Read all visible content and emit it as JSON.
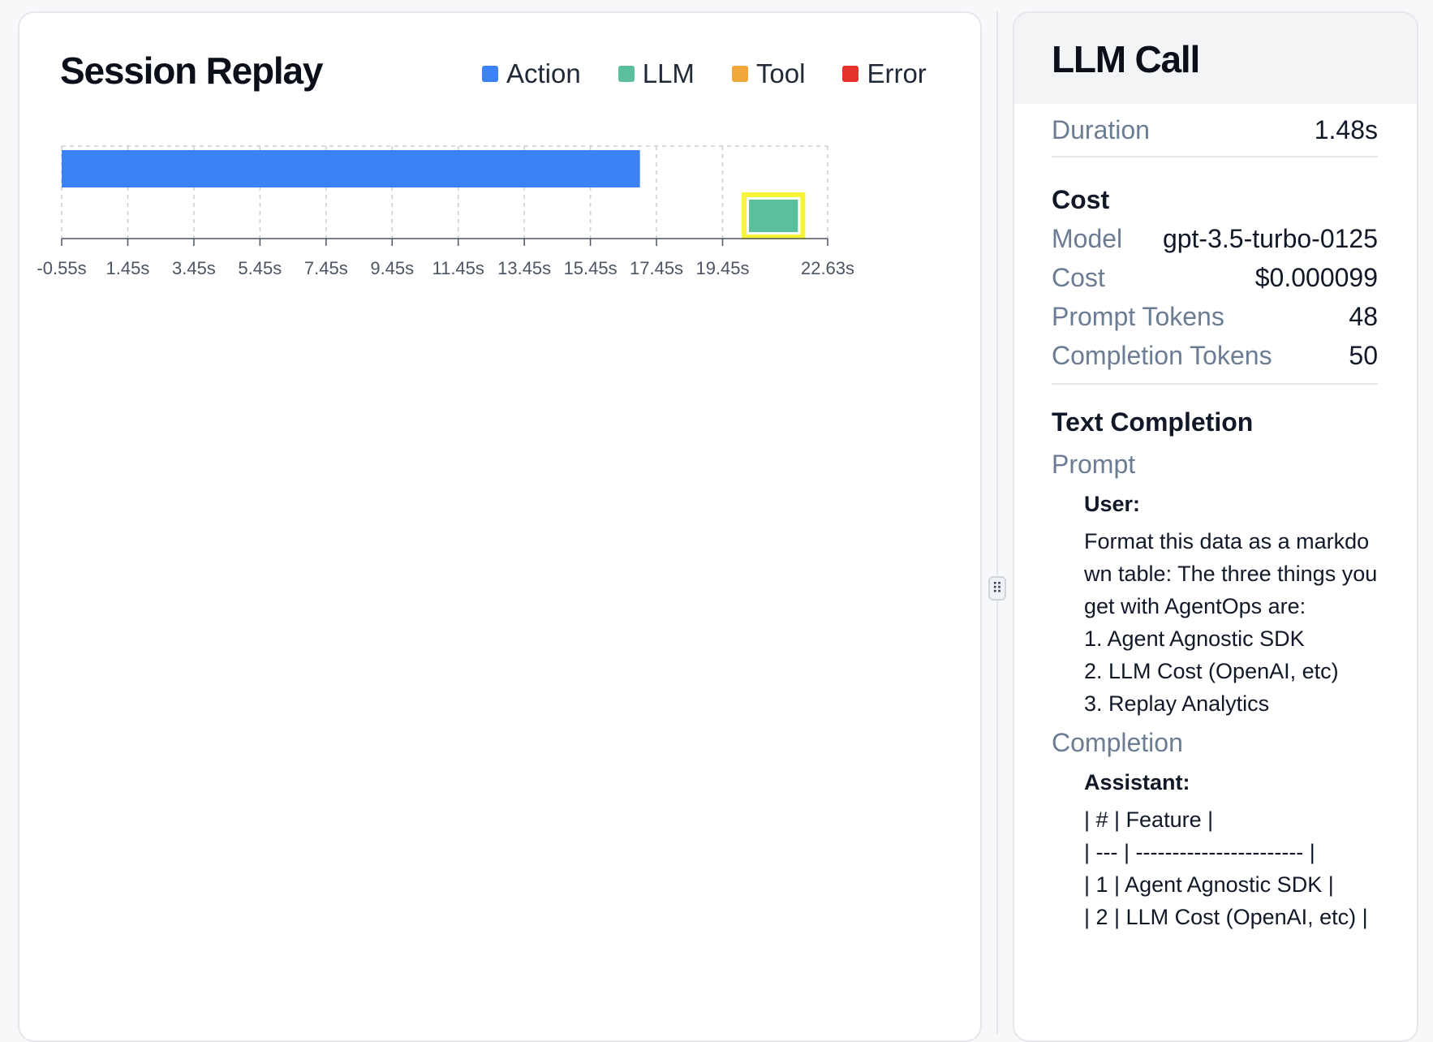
{
  "session_replay": {
    "title": "Session Replay",
    "legend": [
      {
        "label": "Action",
        "color": "#3b82f6"
      },
      {
        "label": "LLM",
        "color": "#5ac09b"
      },
      {
        "label": "Tool",
        "color": "#f0a83a"
      },
      {
        "label": "Error",
        "color": "#e5322d"
      }
    ]
  },
  "chart_data": {
    "type": "bar",
    "orientation": "horizontal-timeline",
    "x_unit": "s",
    "xlim": [
      -0.55,
      22.63
    ],
    "x_ticks": [
      "-0.55s",
      "1.45s",
      "3.45s",
      "5.45s",
      "7.45s",
      "9.45s",
      "11.45s",
      "13.45s",
      "15.45s",
      "17.45s",
      "19.45s",
      "22.63s"
    ],
    "x_tick_values": [
      -0.55,
      1.45,
      3.45,
      5.45,
      7.45,
      9.45,
      11.45,
      13.45,
      15.45,
      17.45,
      19.45,
      22.63
    ],
    "grid": true,
    "legend_position": "top-right",
    "series": [
      {
        "name": "Action",
        "color": "#3b82f6",
        "events": [
          {
            "row": 0,
            "start": -0.55,
            "end": 16.95
          }
        ]
      },
      {
        "name": "LLM",
        "color": "#5ac09b",
        "events": [
          {
            "row": 1,
            "start": 20.25,
            "end": 21.73,
            "selected": true
          }
        ]
      }
    ],
    "highlight_color": "#f7f335"
  },
  "details": {
    "title": "LLM Call",
    "duration": {
      "label": "Duration",
      "value": "1.48s"
    },
    "cost_section": {
      "heading": "Cost",
      "rows": [
        {
          "label": "Model",
          "value": "gpt-3.5-turbo-0125"
        },
        {
          "label": "Cost",
          "value": "$0.000099"
        },
        {
          "label": "Prompt Tokens",
          "value": "48"
        },
        {
          "label": "Completion Tokens",
          "value": "50"
        }
      ]
    },
    "text_completion": {
      "heading": "Text Completion",
      "prompt_label": "Prompt",
      "prompt_role": "User:",
      "prompt_text": "Format this data as a markdown table: The three things you get with AgentOps are:\n1. Agent Agnostic SDK\n2. LLM Cost (OpenAI, etc)\n3. Replay Analytics",
      "completion_label": "Completion",
      "completion_role": "Assistant:",
      "completion_text": "| # | Feature |\n| --- | ----------------------- |\n| 1 | Agent Agnostic SDK |\n| 2 | LLM Cost (OpenAI, etc) |"
    }
  }
}
